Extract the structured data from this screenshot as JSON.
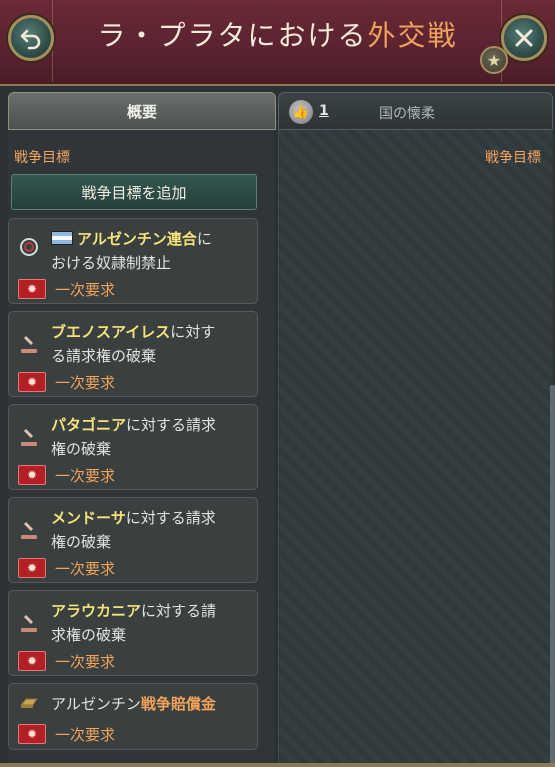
{
  "header": {
    "title_main": "ラ・プラタにおける",
    "title_accent": "外交戦"
  },
  "tabs": {
    "overview": "概要",
    "second_count": "1",
    "second_label": "国の懐柔"
  },
  "left": {
    "section_label": "戦争目標",
    "add_button": "戦争目標を追加"
  },
  "right": {
    "section_label": "戦争目標"
  },
  "goals": [
    {
      "highlight": "アルゼンチン連合",
      "rest1": "に",
      "rest2": "おける奴隷制禁止",
      "requirement": "一次要求",
      "icon": "shackles-icon"
    },
    {
      "highlight": "ブエノスアイレス",
      "rest1": "に対す",
      "rest2": "る請求権の破棄",
      "requirement": "一次要求",
      "icon": "gavel-icon"
    },
    {
      "highlight": "パタゴニア",
      "rest1": "に対する請求",
      "rest2": "権の破棄",
      "requirement": "一次要求",
      "icon": "gavel-icon"
    },
    {
      "highlight": "メンドーサ",
      "rest1": "に対する請求",
      "rest2": "権の破棄",
      "requirement": "一次要求",
      "icon": "gavel-icon"
    },
    {
      "highlight": "アラウカニア",
      "rest1": "に対する請",
      "rest2": "求権の破棄",
      "requirement": "一次要求",
      "icon": "gavel-icon"
    },
    {
      "prefix": "アルゼンチン",
      "accent": "戦争賠償金",
      "requirement": "一次要求",
      "icon": "gold-bars-icon"
    }
  ],
  "colors": {
    "header_bg": "#5a2230",
    "accent_orange": "#f0a35a",
    "highlight_yellow": "#f5e37a",
    "requirement_red": "#b31f25"
  }
}
